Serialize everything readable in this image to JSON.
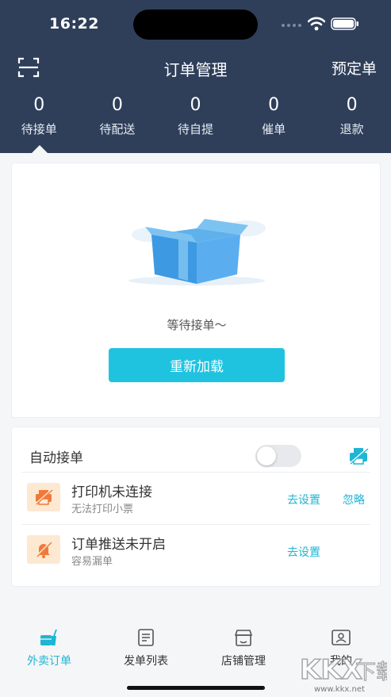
{
  "status_bar": {
    "time": "16:22"
  },
  "nav": {
    "title": "订单管理",
    "preorder_label": "预定单"
  },
  "stats": [
    {
      "count": "0",
      "label": "待接单"
    },
    {
      "count": "0",
      "label": "待配送"
    },
    {
      "count": "0",
      "label": "待自提"
    },
    {
      "count": "0",
      "label": "催单"
    },
    {
      "count": "0",
      "label": "退款"
    }
  ],
  "empty_state": {
    "message": "等待接单～",
    "reload_label": "重新加载"
  },
  "auto_accept": {
    "label": "自动接单",
    "enabled": false
  },
  "alerts": [
    {
      "title": "打印机未连接",
      "subtitle": "无法打印小票",
      "setup_label": "去设置",
      "ignore_label": "忽略"
    },
    {
      "title": "订单推送未开启",
      "subtitle": "容易漏单",
      "setup_label": "去设置"
    }
  ],
  "tabs": [
    {
      "label": "外卖订单",
      "active": true
    },
    {
      "label": "发单列表",
      "active": false
    },
    {
      "label": "店铺管理",
      "active": false
    },
    {
      "label": "我的",
      "active": false
    }
  ],
  "watermark": {
    "text": "KKX下载",
    "url": "www.kkx.net"
  },
  "colors": {
    "header_bg": "#2f3f5a",
    "accent": "#1fc3e0",
    "warning_bg": "#fde9d2",
    "warning_icon": "#f0793a"
  }
}
